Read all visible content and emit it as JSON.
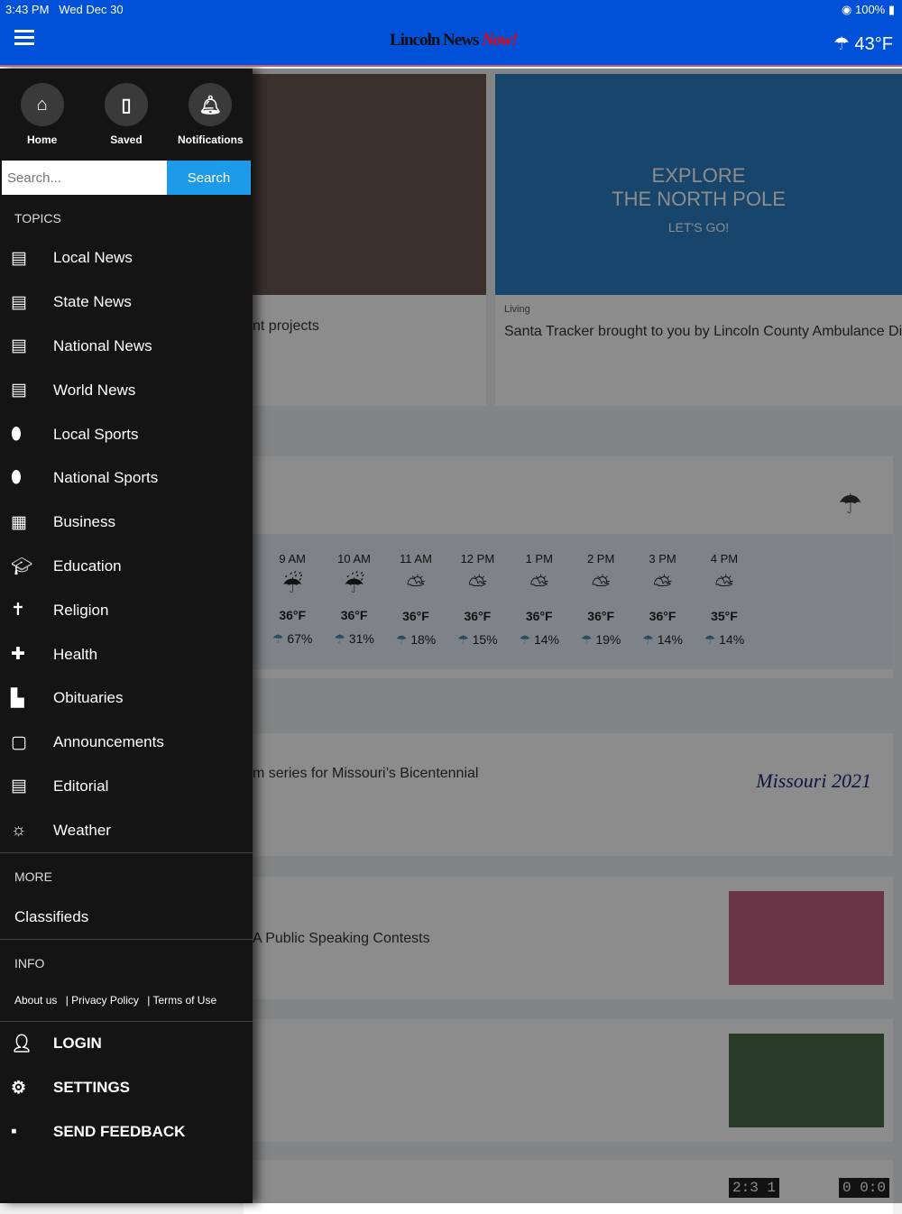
{
  "status_bar": {
    "time": "3:43 PM",
    "date": "Wed Dec 30",
    "battery": "100%"
  },
  "header": {
    "logo_main": "Lincoln News",
    "logo_accent": "Now!",
    "weather_icon": "cloud-rain-icon",
    "temperature": "43°F"
  },
  "drawer": {
    "quick": [
      {
        "label": "Home",
        "icon": "home-icon"
      },
      {
        "label": "Saved",
        "icon": "bookmark-icon"
      },
      {
        "label": "Notifications",
        "icon": "bell-icon"
      }
    ],
    "search": {
      "placeholder": "Search...",
      "button": "Search"
    },
    "topics_header": "TOPICS",
    "topics": [
      {
        "label": "Local News",
        "icon": "newspaper-icon"
      },
      {
        "label": "State News",
        "icon": "newspaper-icon"
      },
      {
        "label": "National News",
        "icon": "newspaper-icon"
      },
      {
        "label": "World News",
        "icon": "newspaper-icon"
      },
      {
        "label": "Local Sports",
        "icon": "football-icon"
      },
      {
        "label": "National Sports",
        "icon": "football-icon"
      },
      {
        "label": "Business",
        "icon": "building-icon"
      },
      {
        "label": "Education",
        "icon": "graduation-cap-icon"
      },
      {
        "label": "Religion",
        "icon": "cross-icon"
      },
      {
        "label": "Health",
        "icon": "medical-bag-icon"
      },
      {
        "label": "Obituaries",
        "icon": "tombstone-icon"
      },
      {
        "label": "Announcements",
        "icon": "message-alert-icon"
      },
      {
        "label": "Editorial",
        "icon": "newspaper-icon"
      },
      {
        "label": "Weather",
        "icon": "weather-partly-cloudy-icon"
      }
    ],
    "more_header": "MORE",
    "more": [
      {
        "label": "Classifieds"
      }
    ],
    "info_header": "INFO",
    "info_links": [
      "About us",
      "Privacy Policy",
      "Terms of Use"
    ],
    "bottom": [
      {
        "label": "LOGIN",
        "icon": "user-icon"
      },
      {
        "label": "SETTINGS",
        "icon": "gear-icon"
      },
      {
        "label": "SEND FEEDBACK",
        "icon": "feedback-icon"
      }
    ]
  },
  "main": {
    "card1_title": "nt projects",
    "card2": {
      "category": "Living",
      "title": "Santa Tracker brought to you by Lincoln County Ambulance Distri",
      "image_text": [
        "EXPLORE",
        "THE NORTH POLE",
        "LET'S GO!"
      ]
    },
    "forecast": [
      {
        "time": "9 AM",
        "icon": "rain-icon",
        "temp": "36°F",
        "precip": "67%"
      },
      {
        "time": "10 AM",
        "icon": "rain-icon",
        "temp": "36°F",
        "precip": "31%"
      },
      {
        "time": "11 AM",
        "icon": "partly-cloudy-icon",
        "temp": "36°F",
        "precip": "18%"
      },
      {
        "time": "12 PM",
        "icon": "partly-cloudy-icon",
        "temp": "36°F",
        "precip": "15%"
      },
      {
        "time": "1 PM",
        "icon": "partly-cloudy-icon",
        "temp": "36°F",
        "precip": "14%"
      },
      {
        "time": "2 PM",
        "icon": "partly-cloudy-icon",
        "temp": "36°F",
        "precip": "19%"
      },
      {
        "time": "3 PM",
        "icon": "partly-cloudy-icon",
        "temp": "36°F",
        "precip": "14%"
      },
      {
        "time": "4 PM",
        "icon": "partly-cloudy-icon",
        "temp": "35°F",
        "precip": "14%"
      }
    ],
    "story3": "m series for Missouri’s Bicentennial",
    "story3_logo": "Missouri 2021",
    "story4": "A Public Speaking Contests",
    "clock_left": "2:3 1",
    "clock_right": "0 0:0"
  }
}
